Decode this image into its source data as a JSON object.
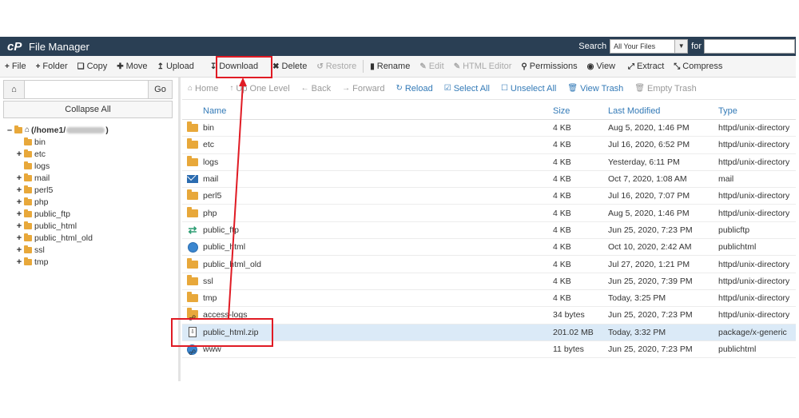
{
  "header": {
    "logo": "cP",
    "title": "File Manager",
    "search_label": "Search",
    "search_scope": "All Your Files",
    "for_label": "for"
  },
  "toolbar": {
    "file": "File",
    "folder": "Folder",
    "copy": "Copy",
    "move": "Move",
    "upload": "Upload",
    "download": "Download",
    "delete": "Delete",
    "restore": "Restore",
    "rename": "Rename",
    "edit": "Edit",
    "html_editor": "HTML Editor",
    "permissions": "Permissions",
    "view": "View",
    "extract": "Extract",
    "compress": "Compress"
  },
  "left": {
    "go_label": "Go",
    "collapse_label": "Collapse All",
    "root_label_prefix": "(/home1/",
    "root_label_suffix": ")",
    "tree": [
      {
        "name": "bin",
        "expandable": false
      },
      {
        "name": "etc",
        "expandable": true
      },
      {
        "name": "logs",
        "expandable": false
      },
      {
        "name": "mail",
        "expandable": true
      },
      {
        "name": "perl5",
        "expandable": true
      },
      {
        "name": "php",
        "expandable": true
      },
      {
        "name": "public_ftp",
        "expandable": true
      },
      {
        "name": "public_html",
        "expandable": true
      },
      {
        "name": "public_html_old",
        "expandable": true
      },
      {
        "name": "ssl",
        "expandable": true
      },
      {
        "name": "tmp",
        "expandable": true
      }
    ]
  },
  "nav": {
    "home": "Home",
    "up": "Up One Level",
    "back": "Back",
    "forward": "Forward",
    "reload": "Reload",
    "select_all": "Select All",
    "unselect_all": "Unselect All",
    "view_trash": "View Trash",
    "empty_trash": "Empty Trash"
  },
  "table": {
    "headers": {
      "name": "Name",
      "size": "Size",
      "modified": "Last Modified",
      "type": "Type"
    },
    "rows": [
      {
        "icon": "folder",
        "name": "bin",
        "size": "4 KB",
        "modified": "Aug 5, 2020, 1:46 PM",
        "type": "httpd/unix-directory"
      },
      {
        "icon": "folder",
        "name": "etc",
        "size": "4 KB",
        "modified": "Jul 16, 2020, 6:52 PM",
        "type": "httpd/unix-directory"
      },
      {
        "icon": "folder",
        "name": "logs",
        "size": "4 KB",
        "modified": "Yesterday, 6:11 PM",
        "type": "httpd/unix-directory"
      },
      {
        "icon": "mail",
        "name": "mail",
        "size": "4 KB",
        "modified": "Oct 7, 2020, 1:08 AM",
        "type": "mail"
      },
      {
        "icon": "folder",
        "name": "perl5",
        "size": "4 KB",
        "modified": "Jul 16, 2020, 7:07 PM",
        "type": "httpd/unix-directory"
      },
      {
        "icon": "folder",
        "name": "php",
        "size": "4 KB",
        "modified": "Aug 5, 2020, 1:46 PM",
        "type": "httpd/unix-directory"
      },
      {
        "icon": "ftp",
        "name": "public_ftp",
        "size": "4 KB",
        "modified": "Jun 25, 2020, 7:23 PM",
        "type": "publicftp"
      },
      {
        "icon": "globe",
        "name": "public_html",
        "size": "4 KB",
        "modified": "Oct 10, 2020, 2:42 AM",
        "type": "publichtml"
      },
      {
        "icon": "folder",
        "name": "public_html_old",
        "size": "4 KB",
        "modified": "Jul 27, 2020, 1:21 PM",
        "type": "httpd/unix-directory"
      },
      {
        "icon": "folder",
        "name": "ssl",
        "size": "4 KB",
        "modified": "Jun 25, 2020, 7:39 PM",
        "type": "httpd/unix-directory"
      },
      {
        "icon": "folder",
        "name": "tmp",
        "size": "4 KB",
        "modified": "Today, 3:25 PM",
        "type": "httpd/unix-directory"
      },
      {
        "icon": "folder-link",
        "name": "access-logs",
        "size": "34 bytes",
        "modified": "Jun 25, 2020, 7:23 PM",
        "type": "httpd/unix-directory"
      },
      {
        "icon": "zip",
        "name": "public_html.zip",
        "size": "201.02 MB",
        "modified": "Today, 3:32 PM",
        "type": "package/x-generic",
        "selected": true
      },
      {
        "icon": "globe-link",
        "name": "www",
        "size": "11 bytes",
        "modified": "Jun 25, 2020, 7:23 PM",
        "type": "publichtml"
      }
    ]
  },
  "colors": {
    "header_bg": "#2a3f54",
    "link": "#337ab7",
    "folder": "#e8a83a",
    "selected_row": "#dbeaf7",
    "annotation": "#e01b24"
  }
}
